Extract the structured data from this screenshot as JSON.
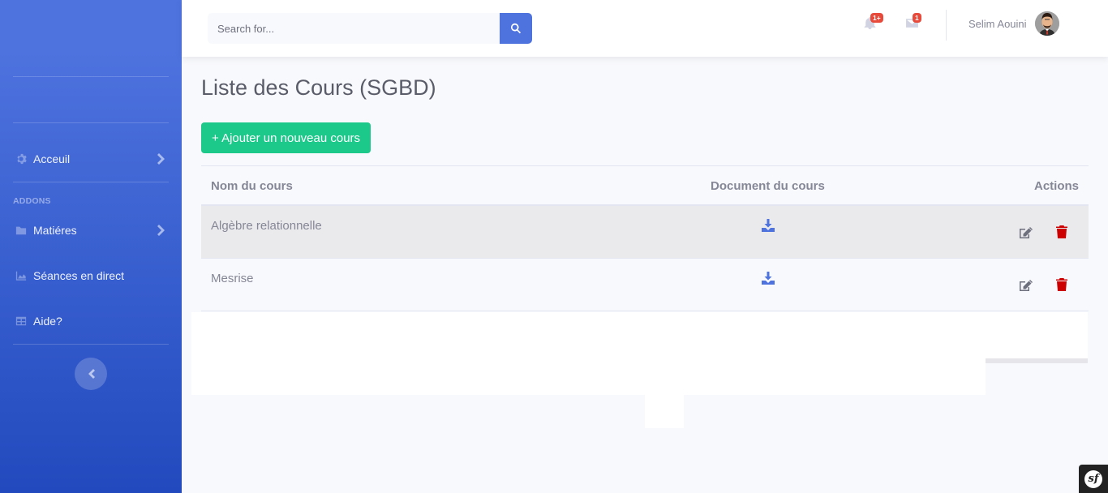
{
  "sidebar": {
    "items": [
      {
        "label": "Acceuil",
        "icon": "gear-icon",
        "has_chevron": true
      },
      {
        "label": "Matiéres",
        "icon": "folder-icon",
        "has_chevron": true
      },
      {
        "label": "Séances en direct",
        "icon": "chart-area-icon",
        "has_chevron": false
      },
      {
        "label": "Aide?",
        "icon": "table-icon",
        "has_chevron": false
      }
    ],
    "heading_addons": "ADDONS",
    "toggle_icon": "chevron-left-icon"
  },
  "topbar": {
    "search_placeholder": "Search for...",
    "search_icon": "search-icon",
    "alerts_badge": "1+",
    "messages_badge": "1",
    "user_name": "Selim Aouini"
  },
  "main": {
    "title": "Liste des Cours (SGBD)",
    "add_button": "+ Ajouter un nouveau cours",
    "table": {
      "headers": [
        "Nom du cours",
        "Document du cours",
        "Actions"
      ],
      "rows": [
        {
          "name": "Algèbre relationnelle"
        },
        {
          "name": "Mesrise"
        }
      ]
    }
  },
  "colors": {
    "primary": "#4e73df",
    "success": "#1cc88a",
    "danger": "#cc0000",
    "badge": "#e74a3b"
  },
  "symfony_badge": "sf"
}
